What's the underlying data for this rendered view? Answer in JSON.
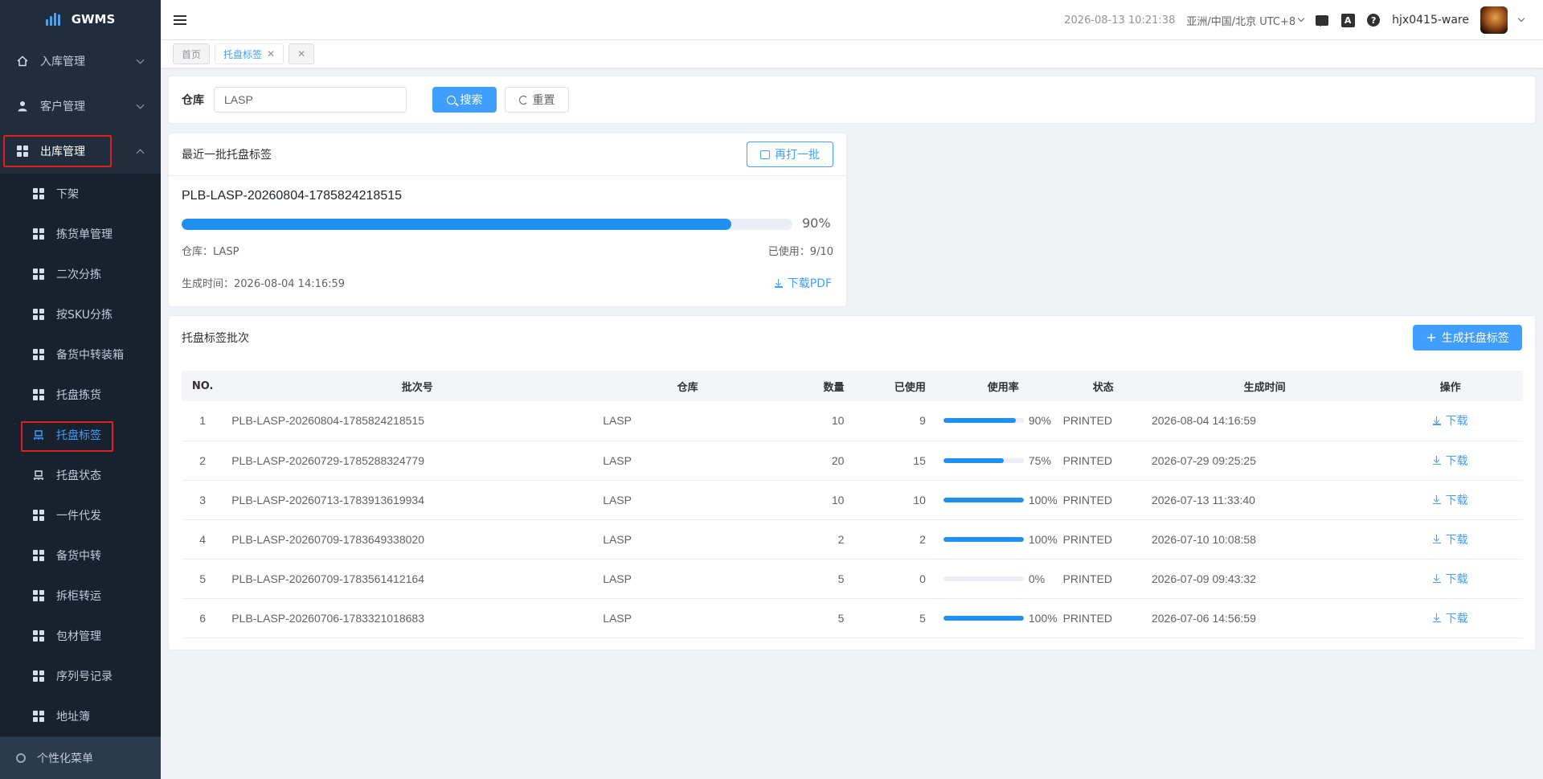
{
  "app": {
    "title": "GWMS"
  },
  "sidebar": {
    "menus": [
      {
        "label": "入库管理",
        "icon": "home-icon",
        "expanded": false
      },
      {
        "label": "客户管理",
        "icon": "user-icon",
        "expanded": false
      },
      {
        "label": "出库管理",
        "icon": "grid-icon",
        "expanded": true
      }
    ],
    "submenu": [
      {
        "label": "下架",
        "icon": "grid-icon"
      },
      {
        "label": "拣货单管理",
        "icon": "grid-icon"
      },
      {
        "label": "二次分拣",
        "icon": "grid-icon"
      },
      {
        "label": "按SKU分拣",
        "icon": "grid-icon"
      },
      {
        "label": "备货中转装箱",
        "icon": "grid-icon"
      },
      {
        "label": "托盘拣货",
        "icon": "grid-icon"
      },
      {
        "label": "托盘标签",
        "icon": "pallet-icon",
        "active": true
      },
      {
        "label": "托盘状态",
        "icon": "pallet-icon"
      },
      {
        "label": "一件代发",
        "icon": "grid-icon"
      },
      {
        "label": "备货中转",
        "icon": "grid-icon"
      },
      {
        "label": "拆柜转运",
        "icon": "grid-icon"
      },
      {
        "label": "包材管理",
        "icon": "grid-icon"
      },
      {
        "label": "序列号记录",
        "icon": "grid-icon"
      },
      {
        "label": "地址簿",
        "icon": "grid-icon"
      }
    ],
    "footer_label": "个性化菜单"
  },
  "header": {
    "datetime": "2026-08-13 10:21:38",
    "timezone": "亚洲/中国/北京 UTC+8",
    "username": "hjx0415-ware",
    "translate_icon_text": "A",
    "help_icon_text": "?"
  },
  "tabs": [
    {
      "label": "首页",
      "active": false
    },
    {
      "label": "托盘标签",
      "active": true
    }
  ],
  "search": {
    "warehouse_label": "仓库",
    "warehouse_value": "LASP",
    "search_button": "搜索",
    "reset_button": "重置"
  },
  "latest": {
    "title": "最近一批托盘标签",
    "reprint_button": "再打一批",
    "batch_no": "PLB-LASP-20260804-1785824218515",
    "progress_percent": 90,
    "progress_text": "90%",
    "warehouse_text": "仓库：LASP",
    "used_text": "已使用：9/10",
    "created_text": "生成时间：2026-08-04 14:16:59",
    "download_pdf": "下载PDF"
  },
  "batches": {
    "title": "托盘标签批次",
    "create_button": "生成托盘标签",
    "columns": [
      "NO.",
      "批次号",
      "仓库",
      "数量",
      "已使用",
      "使用率",
      "状态",
      "生成时间",
      "操作"
    ],
    "rows": [
      {
        "no": "1",
        "batch": "PLB-LASP-20260804-1785824218515",
        "warehouse": "LASP",
        "qty": "10",
        "used": "9",
        "rate": 90,
        "rate_text": "90%",
        "status": "PRINTED",
        "time": "2026-08-04 14:16:59",
        "op": "下载"
      },
      {
        "no": "2",
        "batch": "PLB-LASP-20260729-1785288324779",
        "warehouse": "LASP",
        "qty": "20",
        "used": "15",
        "rate": 75,
        "rate_text": "75%",
        "status": "PRINTED",
        "time": "2026-07-29 09:25:25",
        "op": "下载"
      },
      {
        "no": "3",
        "batch": "PLB-LASP-20260713-1783913619934",
        "warehouse": "LASP",
        "qty": "10",
        "used": "10",
        "rate": 100,
        "rate_text": "100%",
        "status": "PRINTED",
        "time": "2026-07-13 11:33:40",
        "op": "下载"
      },
      {
        "no": "4",
        "batch": "PLB-LASP-20260709-1783649338020",
        "warehouse": "LASP",
        "qty": "2",
        "used": "2",
        "rate": 100,
        "rate_text": "100%",
        "status": "PRINTED",
        "time": "2026-07-10 10:08:58",
        "op": "下载"
      },
      {
        "no": "5",
        "batch": "PLB-LASP-20260709-1783561412164",
        "warehouse": "LASP",
        "qty": "5",
        "used": "0",
        "rate": 0,
        "rate_text": "0%",
        "status": "PRINTED",
        "time": "2026-07-09 09:43:32",
        "op": "下载"
      },
      {
        "no": "6",
        "batch": "PLB-LASP-20260706-1783321018683",
        "warehouse": "LASP",
        "qty": "5",
        "used": "5",
        "rate": 100,
        "rate_text": "100%",
        "status": "PRINTED",
        "time": "2026-07-06 14:56:59",
        "op": "下载"
      }
    ]
  },
  "colors": {
    "primary": "#409eff",
    "sidebar_bg": "#1f2d3d",
    "progress": "#1f8ff0",
    "highlight": "#e02020"
  }
}
